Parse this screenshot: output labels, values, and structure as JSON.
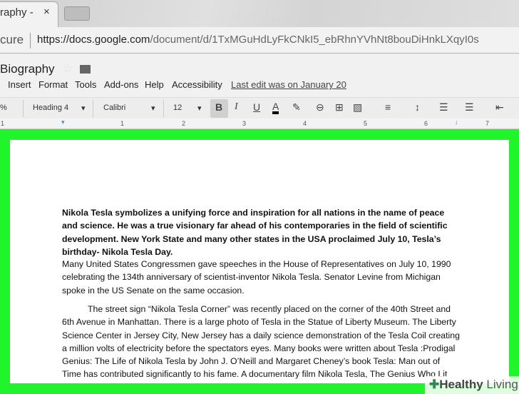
{
  "browser": {
    "tab_title": "raphy -",
    "tab_close": "×",
    "secure_label": "cure",
    "url_domain": "https://docs.google.com",
    "url_path": "/document/d/1TxMGuHdLyFkCNkI5_ebRhnYVhNt8bouDiHnkLXqyI0s"
  },
  "doc": {
    "title": "Biography",
    "menu": [
      "Insert",
      "Format",
      "Tools",
      "Add-ons",
      "Help",
      "Accessibility"
    ],
    "last_edit": "Last edit was on January 20"
  },
  "toolbar": {
    "zoom": "%",
    "style": "Heading 4",
    "font": "Calibri",
    "size": "12",
    "bold": "B",
    "italic": "I",
    "underline": "U",
    "color": "A"
  },
  "ruler": [
    "1",
    "1",
    "2",
    "3",
    "4",
    "5",
    "6",
    "7"
  ],
  "body": {
    "p1": "Nikola Tesla symbolizes a unifying force and inspiration for all nations in the name of peace and science. He was a true visionary far ahead of his contemporaries in the field of scientific development. New York State and many other states in the USA proclaimed July 10, Tesla’s birthday- Nikola Tesla Day.",
    "p2": "Many United States Congressmen gave speeches in the House of Representatives on July 10, 1990 celebrating the 134th anniversary of scientist-inventor Nikola Tesla. Senator Levine from Michigan spoke in the US Senate on the same occasion.",
    "p3": "The street sign “Nikola Tesla Corner” was recently placed on the corner of the 40th Street and 6th Avenue in Manhattan. There is a large photo of Tesla in the Statue of Liberty Museum. The Liberty Science Center in Jersey City, New Jersey has a daily science demonstration of the Tesla Coil creating a million volts of electricity before the spectators eyes. Many books were written about Tesla :Prodigal Genius: The Life of Nikola Tesla by John J. O’Neill  and Margaret Cheney’s book Tesla: Man out of Time has contributed significantly to his fame. A documentary film Nikola Tesla, The Genius Who Lit the World, produced by the Tesla Memorial Society and the Nikola Tesla Museum in Belgrade.The Secret of Nikola"
  },
  "watermark": {
    "word1": "Healthy",
    "word2": "Living"
  }
}
